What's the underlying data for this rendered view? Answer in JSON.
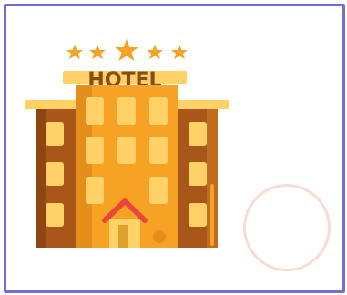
{
  "illustration": {
    "icon": "hotel-icon",
    "sign_text": "HOTEL",
    "stars": 5
  },
  "selector": {
    "icon": "empty-circle",
    "selected": false
  },
  "colors": {
    "frame": "#6f6fd4",
    "circle": "#f8dcd3",
    "tower": "#f6a325",
    "wing": "#a8561a",
    "window": "#ffe08a",
    "roof": "#e9473a",
    "star": "#f6a325"
  }
}
